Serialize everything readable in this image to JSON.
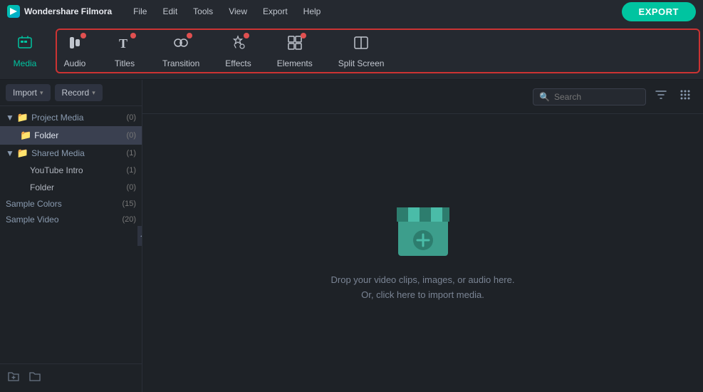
{
  "app": {
    "name": "Wondershare Filmora",
    "logo_text": "W"
  },
  "menu": {
    "items": [
      "File",
      "Edit",
      "Tools",
      "View",
      "Export",
      "Help"
    ]
  },
  "toolbar": {
    "items": [
      {
        "id": "media",
        "label": "Media",
        "icon": "🎞",
        "dot": false,
        "active": true
      },
      {
        "id": "audio",
        "label": "Audio",
        "icon": "♪",
        "dot": true
      },
      {
        "id": "titles",
        "label": "Titles",
        "icon": "T",
        "dot": true
      },
      {
        "id": "transition",
        "label": "Transition",
        "icon": "✦",
        "dot": true
      },
      {
        "id": "effects",
        "label": "Effects",
        "icon": "✧",
        "dot": true
      },
      {
        "id": "elements",
        "label": "Elements",
        "icon": "⊞",
        "dot": true
      },
      {
        "id": "split-screen",
        "label": "Split Screen",
        "icon": "⊡",
        "dot": false
      }
    ],
    "export_label": "EXPORT"
  },
  "sidebar": {
    "import_label": "Import",
    "record_label": "Record",
    "tree": [
      {
        "label": "Project Media",
        "count": "(0)",
        "type": "section",
        "level": 0
      },
      {
        "label": "Folder",
        "count": "(0)",
        "type": "item",
        "level": 1,
        "active": true
      },
      {
        "label": "Shared Media",
        "count": "(1)",
        "type": "section",
        "level": 0
      },
      {
        "label": "YouTube Intro",
        "count": "(1)",
        "type": "item",
        "level": 2
      },
      {
        "label": "Folder",
        "count": "(0)",
        "type": "item",
        "level": 2
      },
      {
        "label": "Sample Colors",
        "count": "(15)",
        "type": "section",
        "level": 0
      },
      {
        "label": "Sample Video",
        "count": "(20)",
        "type": "section",
        "level": 0
      }
    ]
  },
  "content": {
    "search_placeholder": "Search",
    "drop_line1": "Drop your video clips, images, or audio here.",
    "drop_line2": "Or, click here to import media."
  }
}
